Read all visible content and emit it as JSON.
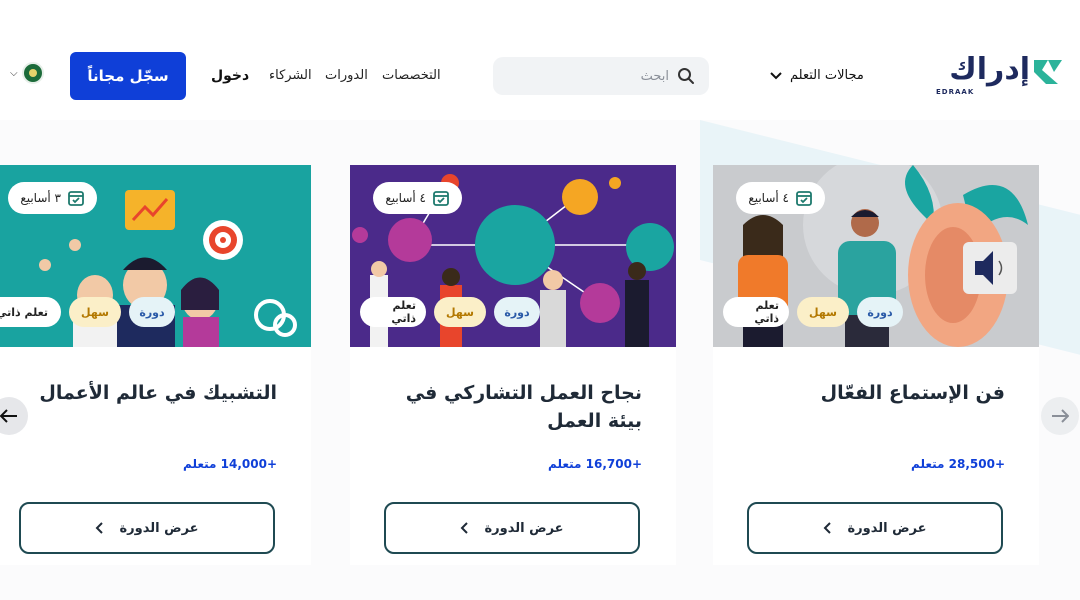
{
  "header": {
    "logo_word": "إدراك",
    "logo_latin": "EDRAAK",
    "learning_fields": "مجالات التعلم",
    "search_placeholder": "ابحث",
    "nav": {
      "specializations": "التخصصات",
      "courses": "الدورات",
      "partners": "الشركاء"
    },
    "login": "دخول",
    "signup": "سجّل مجاناً"
  },
  "cards": [
    {
      "weeks": "٤ أسابيع",
      "type": "دورة",
      "level": "سهل",
      "mode": "تعلم ذاتي",
      "title": "فن الإستماع الفعّال",
      "learners": "+28,500 متعلم",
      "button": "عرض الدورة"
    },
    {
      "weeks": "٤ أسابيع",
      "type": "دورة",
      "level": "سهل",
      "mode": "تعلم ذاتي",
      "title": "نجاح العمل التشاركي في بيئة العمل",
      "learners": "+16,700 متعلم",
      "button": "عرض الدورة"
    },
    {
      "weeks": "٣ أسابيع",
      "type": "دورة",
      "level": "سهل",
      "mode": "تعلم ذاتي",
      "title": "التشبيك في عالم الأعمال",
      "learners": "+14,000 متعلم",
      "button": "عرض الدورة"
    }
  ],
  "colors": {
    "primary": "#0f3fd8",
    "brand_navy": "#1e2a5e",
    "brand_green": "#2bb39a",
    "button_border": "#1f4a52"
  },
  "icons": {
    "search": "search-icon",
    "calendar": "calendar-check-icon",
    "prev": "arrow-left-icon",
    "next": "arrow-right-icon"
  }
}
